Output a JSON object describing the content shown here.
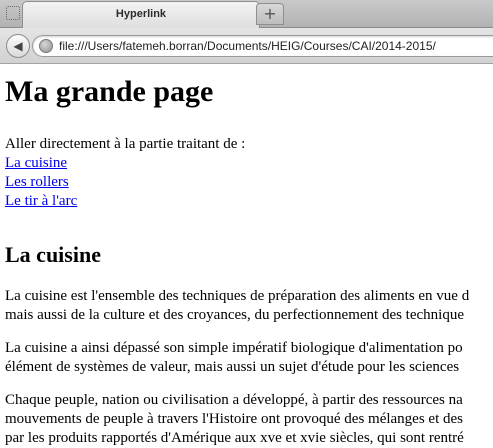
{
  "browser": {
    "tab_title": "Hyperlink",
    "new_tab_label": "+",
    "back_label": "◀",
    "url": "file:///Users/fatemeh.borran/Documents/HEIG/Courses/CAI/2014-2015/"
  },
  "page": {
    "title": "Ma grande page",
    "intro": "Aller directement à la partie traitant de :",
    "links": [
      "La cuisine",
      "Les rollers",
      "Le tir à l'arc"
    ],
    "section_heading": "La cuisine",
    "paragraphs": [
      [
        "La cuisine est l'ensemble des techniques de préparation des aliments en vue d",
        "mais aussi de la culture et des croyances, du perfectionnement des technique"
      ],
      [
        "La cuisine a ainsi dépassé son simple impératif biologique d'alimentation po",
        "élément de systèmes de valeur, mais aussi un sujet d'étude pour les sciences"
      ],
      [
        "Chaque peuple, nation ou civilisation a développé, à partir des ressources na",
        "mouvements de peuple à travers l'Histoire ont provoqué des mélanges et des",
        "par les produits rapportés d'Amérique aux xve et xvie siècles, qui sont rentré"
      ]
    ]
  }
}
